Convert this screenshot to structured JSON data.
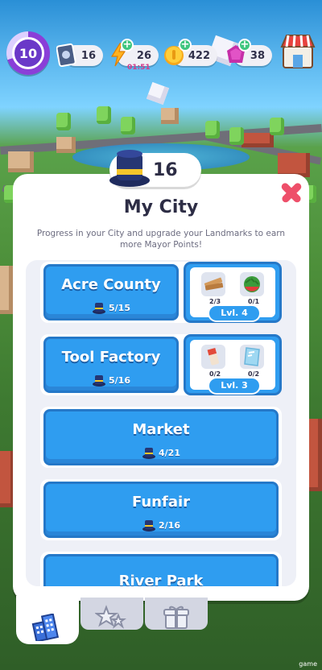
{
  "hud": {
    "level": "10",
    "level_progress": 0.7,
    "cards": "16",
    "energy": "26",
    "energy_timer": "01:51",
    "coins": "422",
    "gems": "38"
  },
  "dialog": {
    "mayor_points": "16",
    "title": "My City",
    "subtitle": "Progress in your City and upgrade your Landmarks to earn more Mayor Points!"
  },
  "landmarks": [
    {
      "name": "Acre County",
      "progress": "5/15",
      "upgrade": {
        "level": "Lvl. 4",
        "resources": [
          {
            "icon": "wood-planks-icon",
            "count": "2/3"
          },
          {
            "icon": "watermelon-icon",
            "count": "0/1"
          }
        ]
      }
    },
    {
      "name": "Tool Factory",
      "progress": "5/16",
      "upgrade": {
        "level": "Lvl. 3",
        "resources": [
          {
            "icon": "paint-tube-icon",
            "count": "0/2"
          },
          {
            "icon": "glass-pane-icon",
            "count": "0/2"
          }
        ]
      }
    },
    {
      "name": "Market",
      "progress": "4/21"
    },
    {
      "name": "Funfair",
      "progress": "2/16"
    },
    {
      "name": "River Park",
      "progress": ""
    }
  ],
  "tabs": [
    {
      "name": "city",
      "icon": "buildings-icon",
      "active": true
    },
    {
      "name": "stars",
      "icon": "stars-icon",
      "active": false
    },
    {
      "name": "gifts",
      "icon": "gift-icon",
      "active": false
    }
  ],
  "watermark": "game",
  "colors": {
    "landmark_blue": "#2f9df0",
    "level_purple": "#6a38c8",
    "plus_green": "#3fc67f",
    "close_red": "#ee4f6a",
    "timer_pink": "#d23a8a"
  }
}
